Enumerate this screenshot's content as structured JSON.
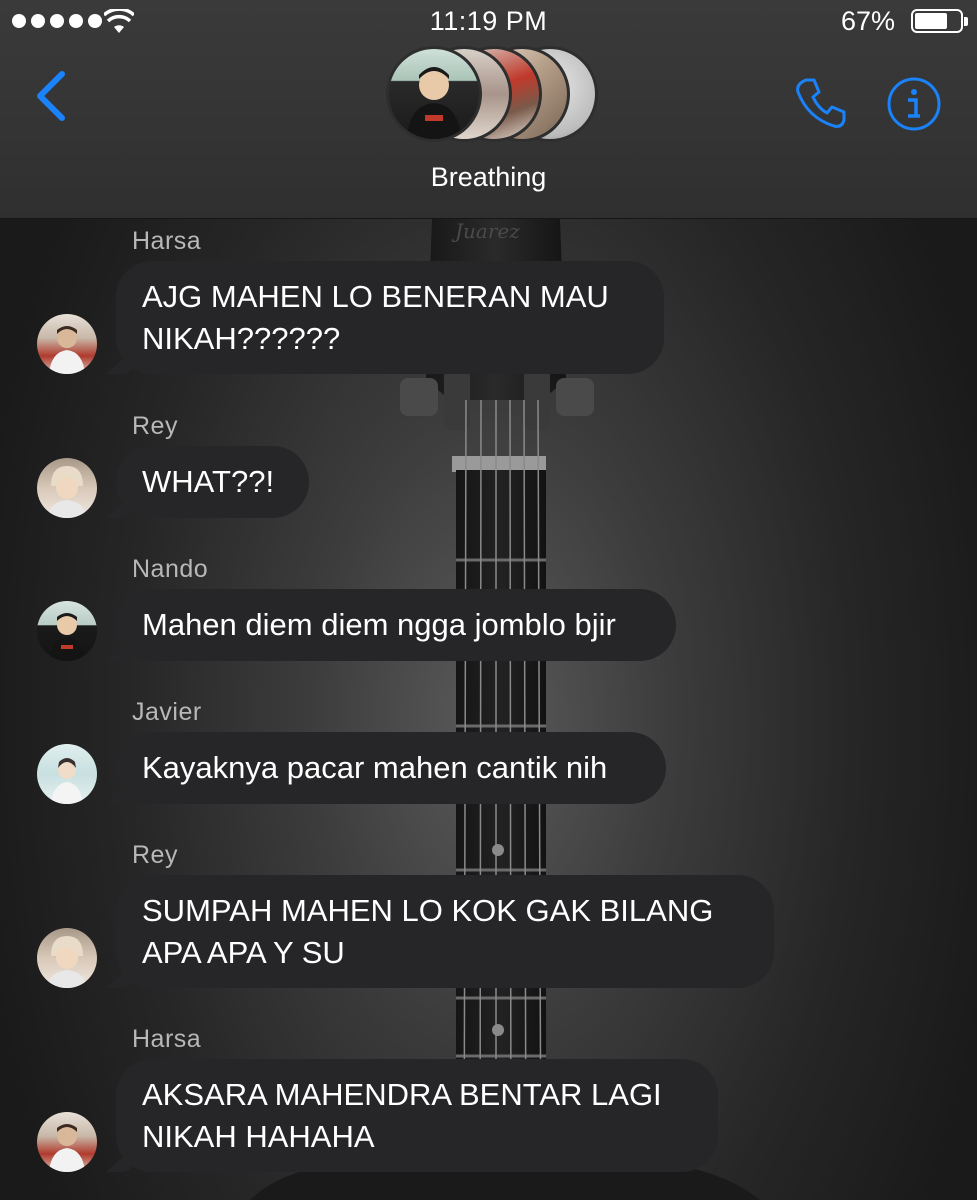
{
  "status_bar": {
    "time": "11:19 PM",
    "battery_percent": "67%",
    "battery_level": 0.67
  },
  "header": {
    "group_name": "Breathing",
    "back_icon": "chevron-left-icon",
    "call_icon": "phone-icon",
    "info_icon": "info-icon",
    "accent_color": "#1a82fb"
  },
  "messages": [
    {
      "sender": "Harsa",
      "lines": [
        "AJG MAHEN LO BENERAN MAU",
        "NIKAH??????"
      ]
    },
    {
      "sender": "Rey",
      "lines": [
        "WHAT??!"
      ]
    },
    {
      "sender": "Nando",
      "lines": [
        "Mahen diem diem ngga jomblo bjir"
      ]
    },
    {
      "sender": "Javier",
      "lines": [
        "Kayaknya pacar mahen cantik nih"
      ]
    },
    {
      "sender": "Rey",
      "lines": [
        "SUMPAH MAHEN LO KOK GAK BILANG",
        "APA APA Y SU"
      ]
    },
    {
      "sender": "Harsa",
      "lines": [
        "AKSARA MAHENDRA BENTAR LAGI",
        "NIKAH HAHAHA"
      ]
    }
  ],
  "background": {
    "bubble_color": "#262628",
    "header_color": "#353535"
  }
}
